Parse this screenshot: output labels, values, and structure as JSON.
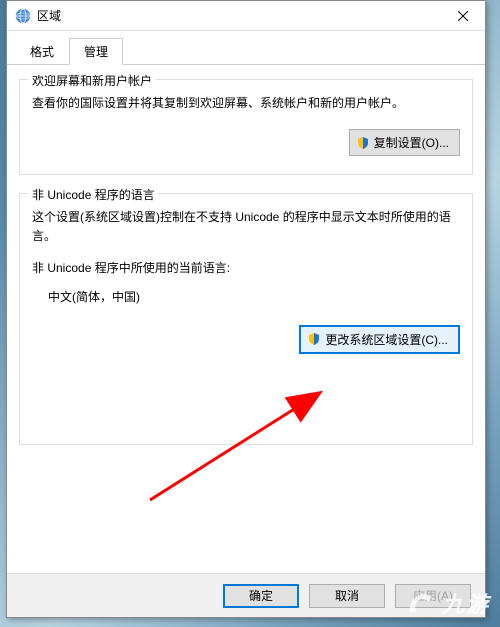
{
  "dialog": {
    "title": "区域",
    "tabs": {
      "format": "格式",
      "admin": "管理"
    },
    "welcome_group": {
      "title": "欢迎屏幕和新用户帐户",
      "text": "查看你的国际设置并将其复制到欢迎屏幕、系统帐户和新的用户帐户。",
      "copy_btn": "复制设置(O)..."
    },
    "nonunicode_group": {
      "title": "非 Unicode 程序的语言",
      "text": "这个设置(系统区域设置)控制在不支持 Unicode 的程序中显示文本时所使用的语言。",
      "current_label": "非 Unicode 程序中所使用的当前语言:",
      "current_value": "中文(简体，中国)",
      "change_btn": "更改系统区域设置(C)..."
    },
    "footer": {
      "ok": "确定",
      "cancel": "取消",
      "apply": "应用(A)"
    }
  },
  "watermark": {
    "text": "九游"
  }
}
